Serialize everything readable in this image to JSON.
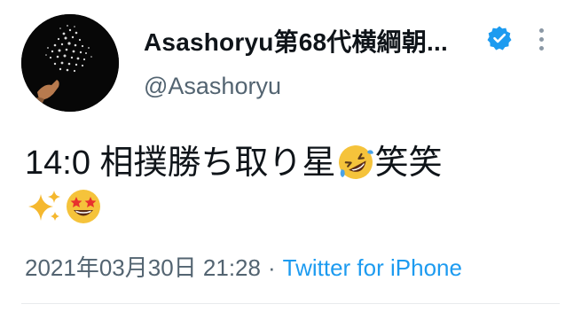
{
  "user": {
    "display_name": "Asashoryu第68代横綱朝...",
    "handle": "@Asashoryu",
    "verified": true,
    "avatar_icon": "profile-avatar"
  },
  "tweet": {
    "line1_text": "14:0 相撲勝ち取り星",
    "line1_emoji": "rolling-on-floor-laughing-emoji",
    "line1_suffix": "笑笑",
    "line2_emojis": [
      "sparkles-emoji",
      "star-struck-emoji"
    ]
  },
  "meta": {
    "timestamp": "2021年03月30日 21:28",
    "separator": "·",
    "source": "Twitter for iPhone"
  },
  "colors": {
    "verified": "#1d9bf0",
    "link": "#1d9bf0",
    "secondary_text": "#536471"
  }
}
